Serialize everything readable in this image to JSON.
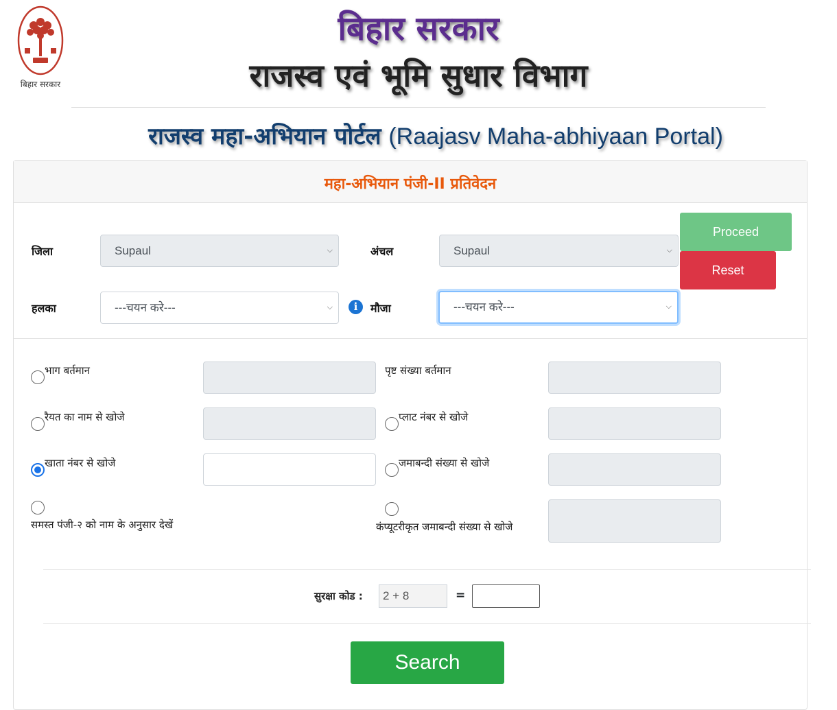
{
  "header": {
    "emblem_caption": "बिहार सरकार",
    "gov_title": "बिहार सरकार",
    "dept_title": "राजस्व एवं भूमि सुधार विभाग",
    "portal_title_hi": "राजस्व महा-अभियान पोर्टल",
    "portal_title_en": "(Raajasv Maha-abhiyaan Portal)"
  },
  "card": {
    "heading": "महा-अभियान पंजी-II प्रतिवेदन"
  },
  "filters": {
    "district_label": "जिला",
    "district_value": "Supaul",
    "circle_label": "अंचल",
    "circle_value": "Supaul",
    "halka_label": "हलका",
    "halka_value": "---चयन करे---",
    "mauja_label": "मौजा",
    "mauja_value": "---चयन करे---",
    "info_glyph": "i"
  },
  "buttons": {
    "proceed": "Proceed",
    "reset": "Reset",
    "search": "Search"
  },
  "search_options": {
    "bhag": "भाग बर्तमान",
    "page": "पृष्ट संख्या बर्तमान",
    "raiyat": "रैयत का नाम से खोजे",
    "plot": "प्लाट नंबर से खोजे",
    "khata": "खाता नंबर से खोजे",
    "jamabandi": "जमाबन्दी संख्या से खोजे",
    "all_panji": "समस्त पंजी-२ को नाम के अनुसार देखें",
    "computerized": "कंप्यूटरीकृत जमाबन्दी संख्या से खोजे",
    "selected": "khata"
  },
  "security": {
    "label": "सुरक्षा कोड :",
    "code": "2 + 8",
    "equals": "="
  },
  "colors": {
    "gov_title": "#5b2d8e",
    "portal_title": "#123e6e",
    "heading": "#e8590c",
    "proceed": "#6ec686",
    "reset": "#dc3545",
    "search": "#28a745"
  }
}
